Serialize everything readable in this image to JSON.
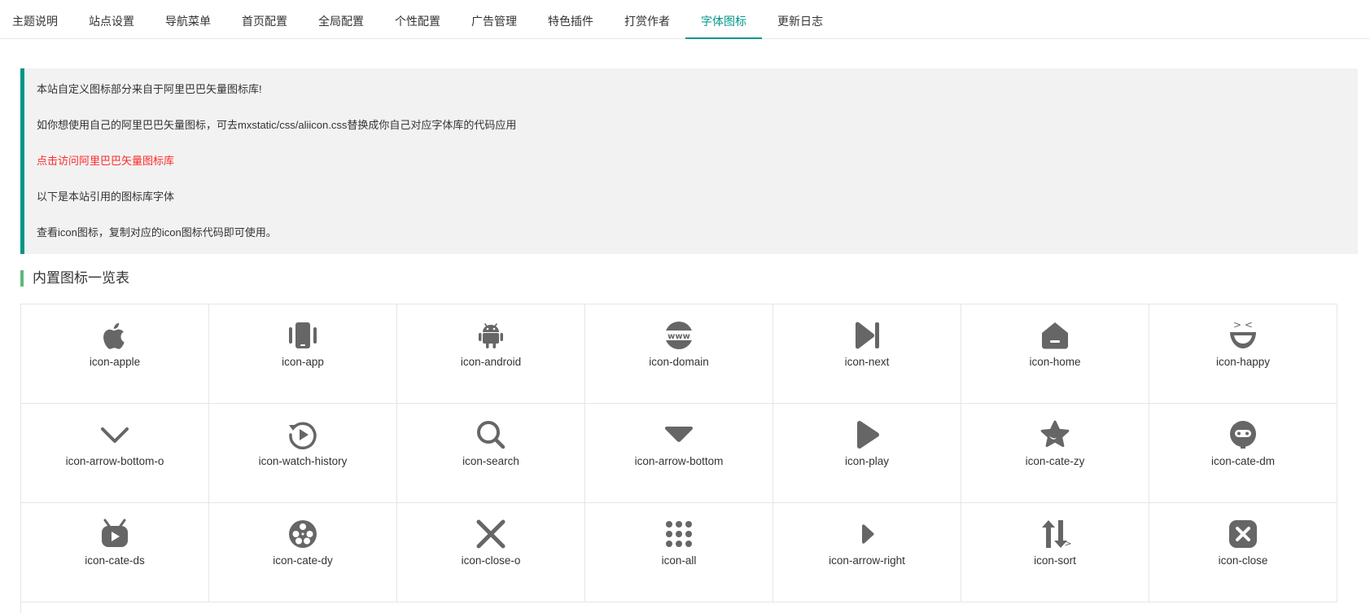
{
  "tabs": [
    {
      "label": "主题说明"
    },
    {
      "label": "站点设置"
    },
    {
      "label": "导航菜单"
    },
    {
      "label": "首页配置"
    },
    {
      "label": "全局配置"
    },
    {
      "label": "个性配置"
    },
    {
      "label": "广告管理"
    },
    {
      "label": "特色插件"
    },
    {
      "label": "打赏作者"
    },
    {
      "label": "字体图标",
      "active": true
    },
    {
      "label": "更新日志"
    }
  ],
  "notice": {
    "line1": "本站自定义图标部分来自于阿里巴巴矢量图标库!",
    "line2": "如你想使用自己的阿里巴巴矢量图标，可去mxstatic/css/aliicon.css替换成你自己对应字体库的代码应用",
    "link": "点击访问阿里巴巴矢量图标库",
    "line4": "以下是本站引用的图标库字体",
    "line5": "查看icon图标，复制对应的icon图标代码即可使用。"
  },
  "section_title": "内置图标一览表",
  "icons": [
    {
      "label": "icon-apple",
      "icon": "apple-icon"
    },
    {
      "label": "icon-app",
      "icon": "app-icon"
    },
    {
      "label": "icon-android",
      "icon": "android-icon"
    },
    {
      "label": "icon-domain",
      "icon": "domain-icon",
      "text": "www"
    },
    {
      "label": "icon-next",
      "icon": "next-icon"
    },
    {
      "label": "icon-home",
      "icon": "home-icon"
    },
    {
      "label": "icon-happy",
      "icon": "happy-icon",
      "text": "> <"
    },
    {
      "label": "icon-arrow-bottom-o",
      "icon": "arrow-bottom-o-icon"
    },
    {
      "label": "icon-watch-history",
      "icon": "watch-history-icon"
    },
    {
      "label": "icon-search",
      "icon": "search-icon"
    },
    {
      "label": "icon-arrow-bottom",
      "icon": "arrow-bottom-icon"
    },
    {
      "label": "icon-play",
      "icon": "play-icon"
    },
    {
      "label": "icon-cate-zy",
      "icon": "cate-zy-icon"
    },
    {
      "label": "icon-cate-dm",
      "icon": "cate-dm-icon"
    },
    {
      "label": "icon-cate-ds",
      "icon": "cate-ds-icon"
    },
    {
      "label": "icon-cate-dy",
      "icon": "cate-dy-icon"
    },
    {
      "label": "icon-close-o",
      "icon": "close-o-icon"
    },
    {
      "label": "icon-all",
      "icon": "all-icon"
    },
    {
      "label": "icon-arrow-right",
      "icon": "arrow-right-icon"
    },
    {
      "label": "icon-sort",
      "icon": "sort-icon",
      "text": ">"
    },
    {
      "label": "icon-close",
      "icon": "close-icon"
    }
  ],
  "colors": {
    "accent": "#009688",
    "section_bar": "#5fb878",
    "link": "#ff2b2b",
    "icon": "#666666",
    "notice_bg": "#f2f2f2"
  }
}
